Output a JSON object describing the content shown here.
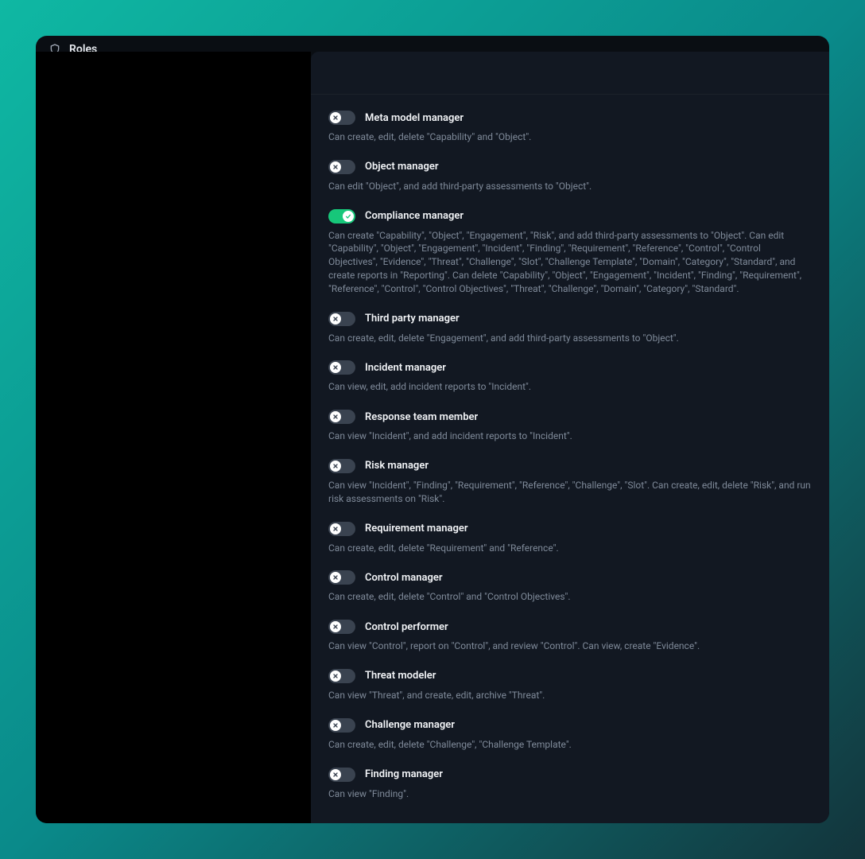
{
  "header": {
    "title": "Roles"
  },
  "roles": [
    {
      "label": "Meta model manager",
      "enabled": false,
      "description": "Can create, edit, delete \"Capability\" and \"Object\"."
    },
    {
      "label": "Object manager",
      "enabled": false,
      "description": "Can edit \"Object\", and add third-party assessments to \"Object\"."
    },
    {
      "label": "Compliance manager",
      "enabled": true,
      "description": "Can create \"Capability\", \"Object\", \"Engagement\", \"Risk\", and add third-party assessments to \"Object\". Can edit \"Capability\", \"Object\", \"Engagement\", \"Incident\", \"Finding\", \"Requirement\", \"Reference\", \"Control\", \"Control Objectives\", \"Evidence\", \"Threat\", \"Challenge\", \"Slot\", \"Challenge Template\", \"Domain\", \"Category\", \"Standard\", and create reports in \"Reporting\". Can delete \"Capability\", \"Object\", \"Engagement\", \"Incident\", \"Finding\", \"Requirement\", \"Reference\", \"Control\", \"Control Objectives\", \"Threat\", \"Challenge\", \"Domain\", \"Category\", \"Standard\"."
    },
    {
      "label": "Third party manager",
      "enabled": false,
      "description": "Can create, edit, delete \"Engagement\", and add third-party assessments to \"Object\"."
    },
    {
      "label": "Incident manager",
      "enabled": false,
      "description": "Can view, edit, add incident reports to \"Incident\"."
    },
    {
      "label": "Response team member",
      "enabled": false,
      "description": "Can view \"Incident\", and add incident reports to \"Incident\"."
    },
    {
      "label": "Risk manager",
      "enabled": false,
      "description": "Can view \"Incident\", \"Finding\", \"Requirement\", \"Reference\", \"Challenge\", \"Slot\". Can create, edit, delete \"Risk\", and run risk assessments on \"Risk\"."
    },
    {
      "label": "Requirement manager",
      "enabled": false,
      "description": "Can create, edit, delete \"Requirement\" and \"Reference\"."
    },
    {
      "label": "Control manager",
      "enabled": false,
      "description": "Can create, edit, delete \"Control\" and \"Control Objectives\"."
    },
    {
      "label": "Control performer",
      "enabled": false,
      "description": "Can view \"Control\", report on \"Control\", and review \"Control\". Can view, create \"Evidence\"."
    },
    {
      "label": "Threat modeler",
      "enabled": false,
      "description": "Can view \"Threat\", and create, edit, archive \"Threat\"."
    },
    {
      "label": "Challenge manager",
      "enabled": false,
      "description": "Can create, edit, delete \"Challenge\", \"Challenge Template\"."
    },
    {
      "label": "Finding manager",
      "enabled": false,
      "description": "Can view \"Finding\"."
    }
  ]
}
